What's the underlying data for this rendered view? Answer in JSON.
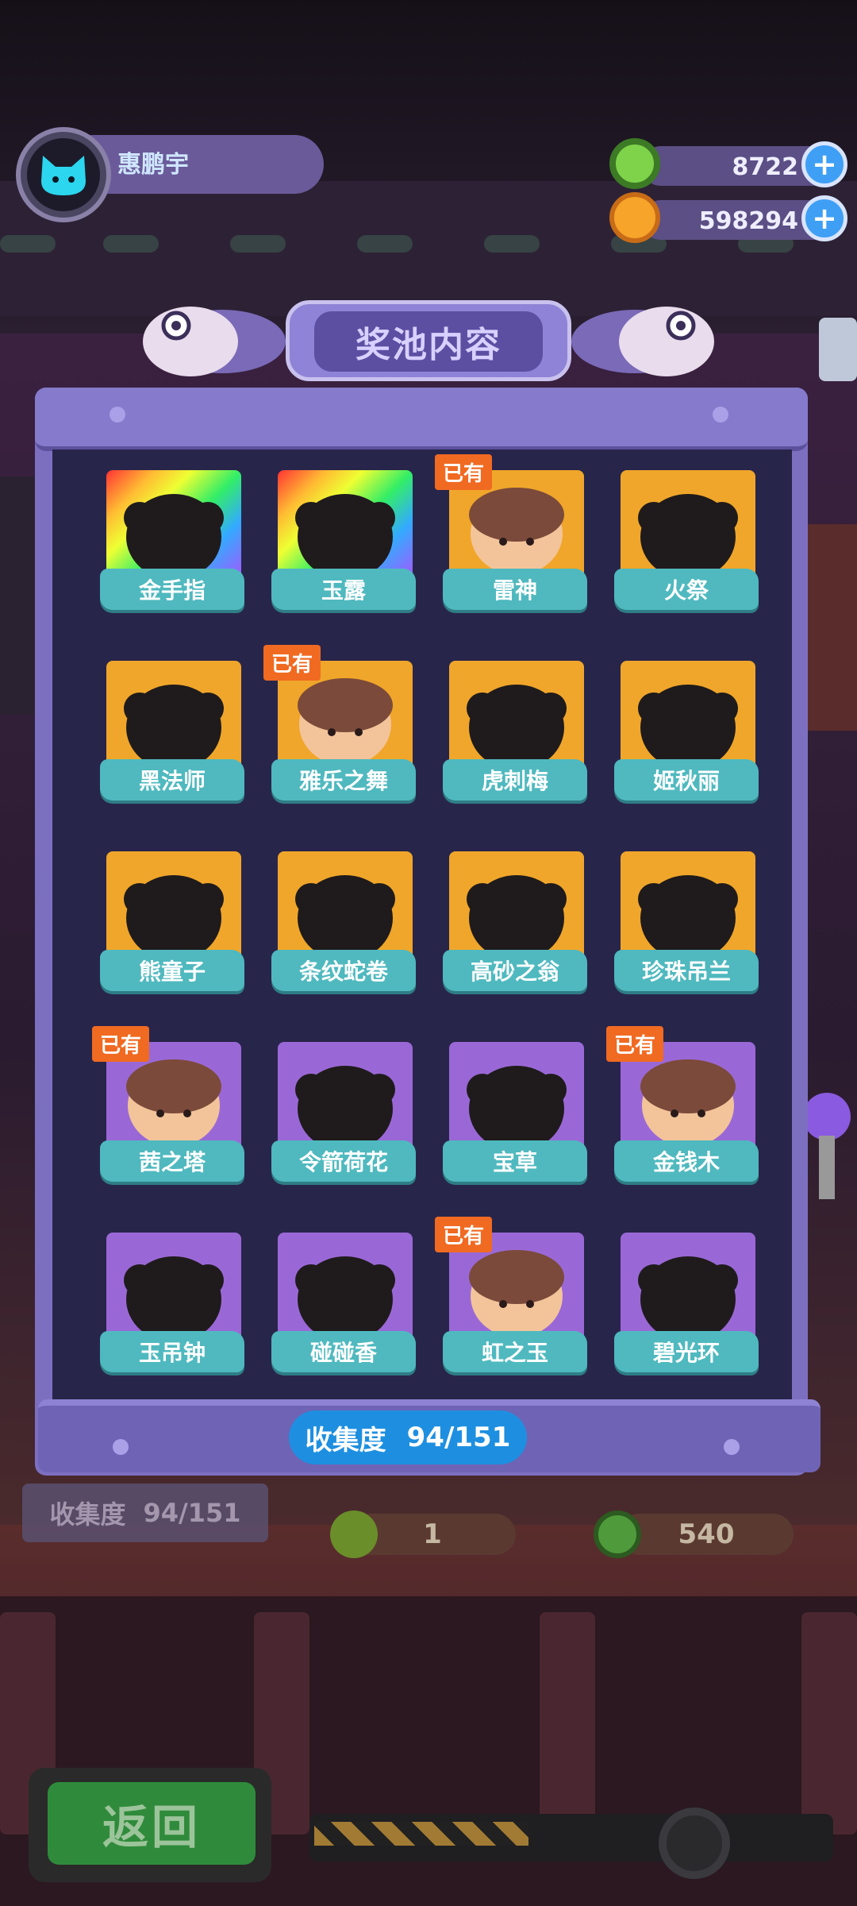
{
  "header": {
    "player_name": "惠鹏宇",
    "currencies": [
      {
        "name": "green-donut-coin",
        "value": "8722",
        "color": "#7ed34b"
      },
      {
        "name": "orange-planet-coin",
        "value": "598294",
        "color": "#f6a42a"
      }
    ]
  },
  "panel": {
    "title": "奖池内容",
    "owned_badge": "已有",
    "items": [
      {
        "name": "金手指",
        "rarity": "rainbow",
        "owned": false
      },
      {
        "name": "玉露",
        "rarity": "rainbow",
        "owned": false
      },
      {
        "name": "雷神",
        "rarity": "gold",
        "owned": true
      },
      {
        "name": "火祭",
        "rarity": "gold",
        "owned": false
      },
      {
        "name": "黑法师",
        "rarity": "gold",
        "owned": false
      },
      {
        "name": "雅乐之舞",
        "rarity": "gold",
        "owned": true
      },
      {
        "name": "虎刺梅",
        "rarity": "gold",
        "owned": false
      },
      {
        "name": "姬秋丽",
        "rarity": "gold",
        "owned": false
      },
      {
        "name": "熊童子",
        "rarity": "gold",
        "owned": false
      },
      {
        "name": "条纹蛇卷",
        "rarity": "gold",
        "owned": false
      },
      {
        "name": "高砂之翁",
        "rarity": "gold",
        "owned": false
      },
      {
        "name": "珍珠吊兰",
        "rarity": "gold",
        "owned": false
      },
      {
        "name": "茜之塔",
        "rarity": "purple",
        "owned": true
      },
      {
        "name": "令箭荷花",
        "rarity": "purple",
        "owned": false
      },
      {
        "name": "宝草",
        "rarity": "purple",
        "owned": false
      },
      {
        "name": "金钱木",
        "rarity": "purple",
        "owned": true
      },
      {
        "name": "玉吊钟",
        "rarity": "purple",
        "owned": false
      },
      {
        "name": "碰碰香",
        "rarity": "purple",
        "owned": false
      },
      {
        "name": "虹之玉",
        "rarity": "purple",
        "owned": true
      },
      {
        "name": "碧光环",
        "rarity": "purple",
        "owned": false
      }
    ],
    "collection_label": "收集度",
    "collection_value": "94/151"
  },
  "background_ui": {
    "collection_label": "收集度",
    "collection_value": "94/151",
    "ticket_count": "1",
    "coin_cost": "540"
  },
  "footer": {
    "back_label": "返回"
  }
}
